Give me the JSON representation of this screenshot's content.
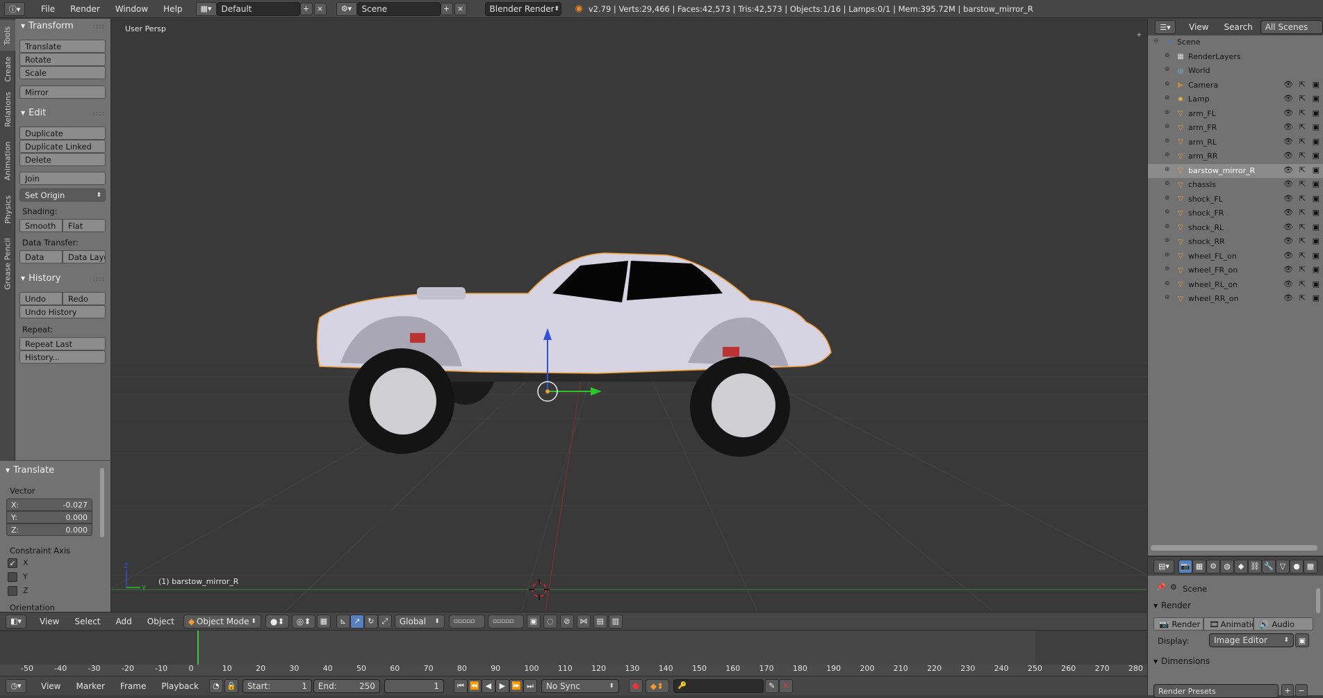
{
  "topbar": {
    "menus": [
      "File",
      "Render",
      "Window",
      "Help"
    ],
    "screen_layout": "Default",
    "scene": "Scene",
    "engine": "Blender Render",
    "stats": "v2.79 | Verts:29,466 | Faces:42,573 | Tris:42,573 | Objects:1/16 | Lamps:0/1 | Mem:395.72M | barstow_mirror_R"
  },
  "tabs": [
    "Tools",
    "Create",
    "Relations",
    "Animation",
    "Physics",
    "Grease Pencil"
  ],
  "toolshelf": {
    "transform": {
      "title": "Transform",
      "buttons": [
        "Translate",
        "Rotate",
        "Scale",
        "Mirror"
      ]
    },
    "edit": {
      "title": "Edit",
      "buttons": [
        "Duplicate",
        "Duplicate Linked",
        "Delete",
        "Join",
        "Set Origin"
      ],
      "shading_label": "Shading:",
      "smooth": "Smooth",
      "flat": "Flat",
      "data_transfer_label": "Data Transfer:",
      "data": "Data",
      "data_layout": "Data Layo"
    },
    "history": {
      "title": "History",
      "undo": "Undo",
      "redo": "Redo",
      "undo_history": "Undo History",
      "repeat_label": "Repeat:",
      "repeat_last": "Repeat Last",
      "history_btn": "History..."
    }
  },
  "operator": {
    "title": "Translate",
    "vector_label": "Vector",
    "x_label": "X:",
    "x": "-0.027",
    "y_label": "Y:",
    "y": "0.000",
    "z_label": "Z:",
    "z": "0.000",
    "constraint_label": "Constraint Axis",
    "axes": [
      {
        "label": "X",
        "checked": true
      },
      {
        "label": "Y",
        "checked": false
      },
      {
        "label": "Z",
        "checked": false
      }
    ],
    "orientation_label": "Orientation"
  },
  "viewport": {
    "view_name": "User Persp",
    "object_label": "(1) barstow_mirror_R"
  },
  "view3d_header": {
    "menus": [
      "View",
      "Select",
      "Add",
      "Object"
    ],
    "mode": "Object Mode",
    "orientation": "Global"
  },
  "timeline": {
    "ticks": [
      "-50",
      "-40",
      "-30",
      "-20",
      "-10",
      "0",
      "10",
      "20",
      "30",
      "40",
      "50",
      "60",
      "70",
      "80",
      "90",
      "100",
      "110",
      "120",
      "130",
      "140",
      "150",
      "160",
      "170",
      "180",
      "190",
      "200",
      "210",
      "220",
      "230",
      "240",
      "250",
      "260",
      "270",
      "280"
    ],
    "menus": [
      "View",
      "Marker",
      "Frame",
      "Playback"
    ],
    "start_label": "Start:",
    "start": "1",
    "end_label": "End:",
    "end": "250",
    "current": "1",
    "sync": "No Sync"
  },
  "outliner": {
    "menus": [
      "View",
      "Search"
    ],
    "filter": "All Scenes",
    "items": [
      {
        "name": "Scene",
        "icon": "scene-icon",
        "indent": 0
      },
      {
        "name": "RenderLayers",
        "icon": "renderlayers-icon",
        "indent": 1
      },
      {
        "name": "World",
        "icon": "world-icon",
        "indent": 1
      },
      {
        "name": "Camera",
        "icon": "camera-icon",
        "indent": 1
      },
      {
        "name": "Lamp",
        "icon": "lamp-icon",
        "indent": 1
      },
      {
        "name": "arm_FL",
        "icon": "mesh-icon",
        "indent": 1
      },
      {
        "name": "arm_FR",
        "icon": "mesh-icon",
        "indent": 1
      },
      {
        "name": "arm_RL",
        "icon": "mesh-icon",
        "indent": 1
      },
      {
        "name": "arm_RR",
        "icon": "mesh-icon",
        "indent": 1
      },
      {
        "name": "barstow_mirror_R",
        "icon": "mesh-icon",
        "indent": 1,
        "selected": true
      },
      {
        "name": "chassis",
        "icon": "mesh-icon",
        "indent": 1
      },
      {
        "name": "shock_FL",
        "icon": "mesh-icon",
        "indent": 1
      },
      {
        "name": "shock_FR",
        "icon": "mesh-icon",
        "indent": 1
      },
      {
        "name": "shock_RL",
        "icon": "mesh-icon",
        "indent": 1
      },
      {
        "name": "shock_RR",
        "icon": "mesh-icon",
        "indent": 1
      },
      {
        "name": "wheel_FL_on",
        "icon": "mesh-icon",
        "indent": 1
      },
      {
        "name": "wheel_FR_on",
        "icon": "mesh-icon",
        "indent": 1
      },
      {
        "name": "wheel_RL_on",
        "icon": "mesh-icon",
        "indent": 1
      },
      {
        "name": "wheel_RR_on",
        "icon": "mesh-icon",
        "indent": 1
      }
    ]
  },
  "properties": {
    "context": "Scene",
    "render_title": "Render",
    "render_btn": "Render",
    "animation_btn": "Animation",
    "audio_btn": "Audio",
    "display_label": "Display:",
    "display_value": "Image Editor",
    "dimensions_title": "Dimensions",
    "presets": "Render Presets"
  },
  "colors": {
    "selection": "#f39a2e",
    "axis_x": "#c43b3b",
    "axis_y": "#2ec42e",
    "axis_z": "#3050e0",
    "playhead": "#3ec43e"
  }
}
